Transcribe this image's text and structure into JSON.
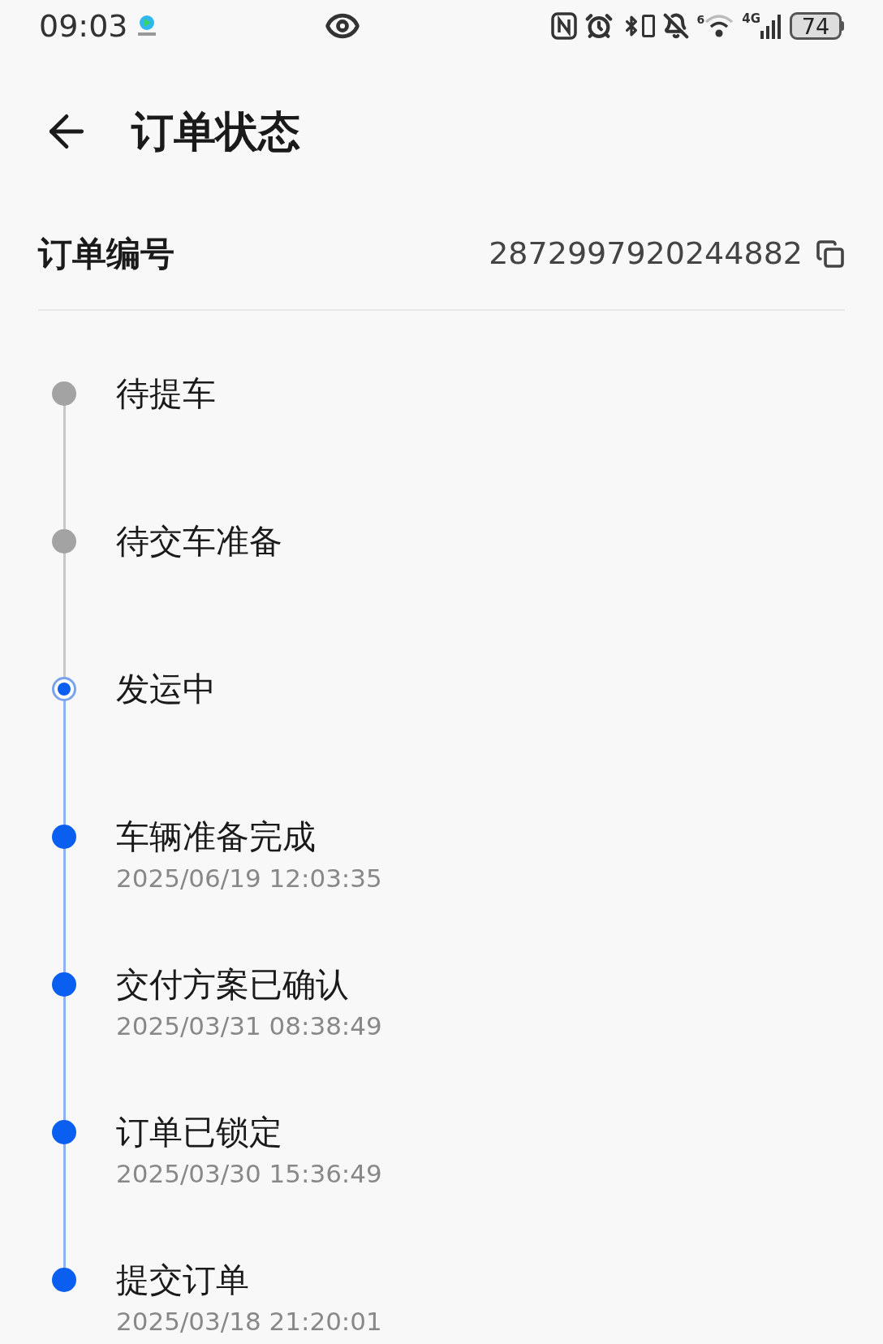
{
  "status_bar": {
    "time": "09:03",
    "battery": "74",
    "network": "4G",
    "wifi_badge": "6"
  },
  "header": {
    "title": "订单状态"
  },
  "order": {
    "label": "订单编号",
    "number": "2872997920244882"
  },
  "steps": [
    {
      "label": "待提车",
      "done": false,
      "current": false
    },
    {
      "label": "待交车准备",
      "done": false,
      "current": false
    },
    {
      "label": "发运中",
      "done": false,
      "current": true
    },
    {
      "label": "车辆准备完成",
      "done": true,
      "current": false,
      "time": "2025/06/19 12:03:35"
    },
    {
      "label": "交付方案已确认",
      "done": true,
      "current": false,
      "time": "2025/03/31 08:38:49"
    },
    {
      "label": "订单已锁定",
      "done": true,
      "current": false,
      "time": "2025/03/30 15:36:49"
    },
    {
      "label": "提交订单",
      "done": true,
      "current": false,
      "time": "2025/03/18 21:20:01"
    }
  ]
}
